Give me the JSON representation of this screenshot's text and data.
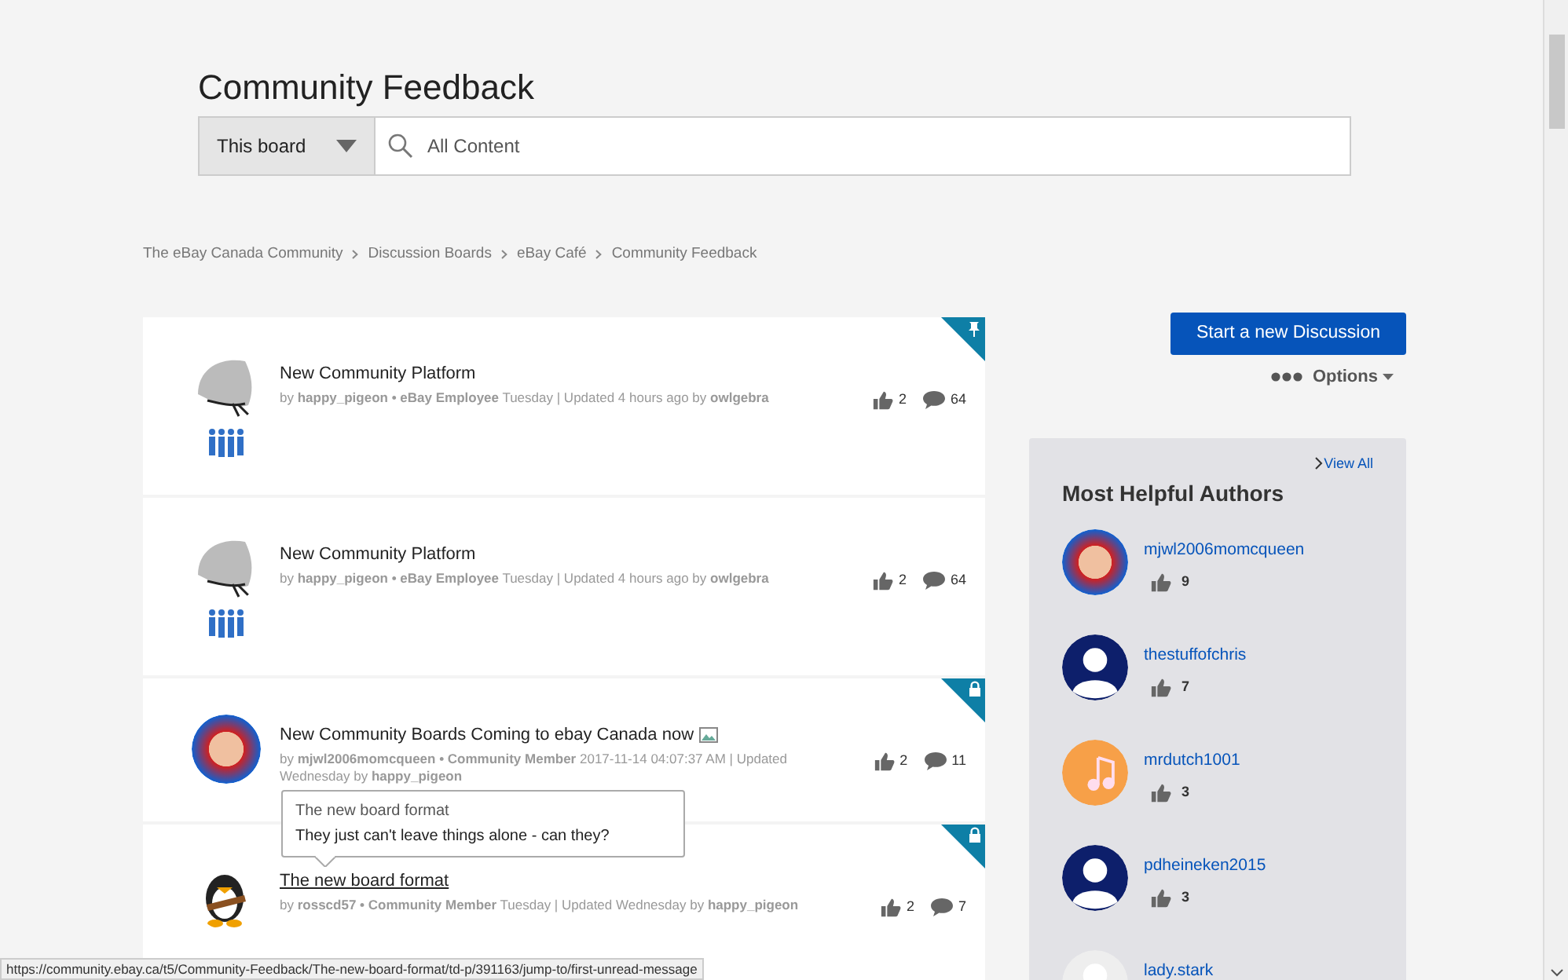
{
  "page_title": "Community Feedback",
  "search": {
    "scope": "This board",
    "placeholder": "All Content"
  },
  "breadcrumbs": [
    "The eBay Canada Community",
    "Discussion Boards",
    "eBay Café",
    "Community Feedback"
  ],
  "posts": [
    {
      "title": "New Community Platform",
      "meta": "by **happy_pigeon • eBay Employee** Tuesday | Updated 4 hours ago by **owlgebra**",
      "kudos": "2",
      "replies": "64",
      "pinned": true,
      "locked": false,
      "staff_badge": true,
      "has_image": false,
      "hovered": false
    },
    {
      "title": "New Community Platform",
      "meta": "by **happy_pigeon • eBay Employee** Tuesday | Updated 4 hours ago by **owlgebra**",
      "kudos": "2",
      "replies": "64",
      "pinned": false,
      "locked": false,
      "staff_badge": true,
      "has_image": false,
      "hovered": false
    },
    {
      "title": "New Community Boards Coming to ebay Canada now",
      "meta": "by **mjwl2006momcqueen • Community Member** 2017-11-14 04:07:37 AM | Updated Wednesday by **happy_pigeon**",
      "kudos": "2",
      "replies": "11",
      "pinned": false,
      "locked": true,
      "staff_badge": false,
      "has_image": true,
      "hovered": false
    },
    {
      "title": "The new board format",
      "meta": "by **rosscd57 • Community Member** Tuesday | Updated Wednesday by **happy_pigeon**",
      "kudos": "2",
      "replies": "7",
      "pinned": false,
      "locked": true,
      "staff_badge": false,
      "has_image": false,
      "hovered": true
    }
  ],
  "tooltip": {
    "title": "The new board format",
    "text": "They just can't leave things alone - can they?"
  },
  "new_discussion_button": "Start a new Discussion",
  "options_menu": "Options",
  "helpful_authors": {
    "title": "Most Helpful Authors",
    "view_all": "View All",
    "authors": [
      {
        "name": "mjwl2006momcqueen",
        "kudos": "9"
      },
      {
        "name": "thestuffofchris",
        "kudos": "7"
      },
      {
        "name": "mrdutch1001",
        "kudos": "3"
      },
      {
        "name": "pdheineken2015",
        "kudos": "3"
      },
      {
        "name": "lady.stark"
      }
    ]
  },
  "status_url": "https://community.ebay.ca/t5/Community-Feedback/The-new-board-format/td-p/391163/jump-to/first-unread-message"
}
